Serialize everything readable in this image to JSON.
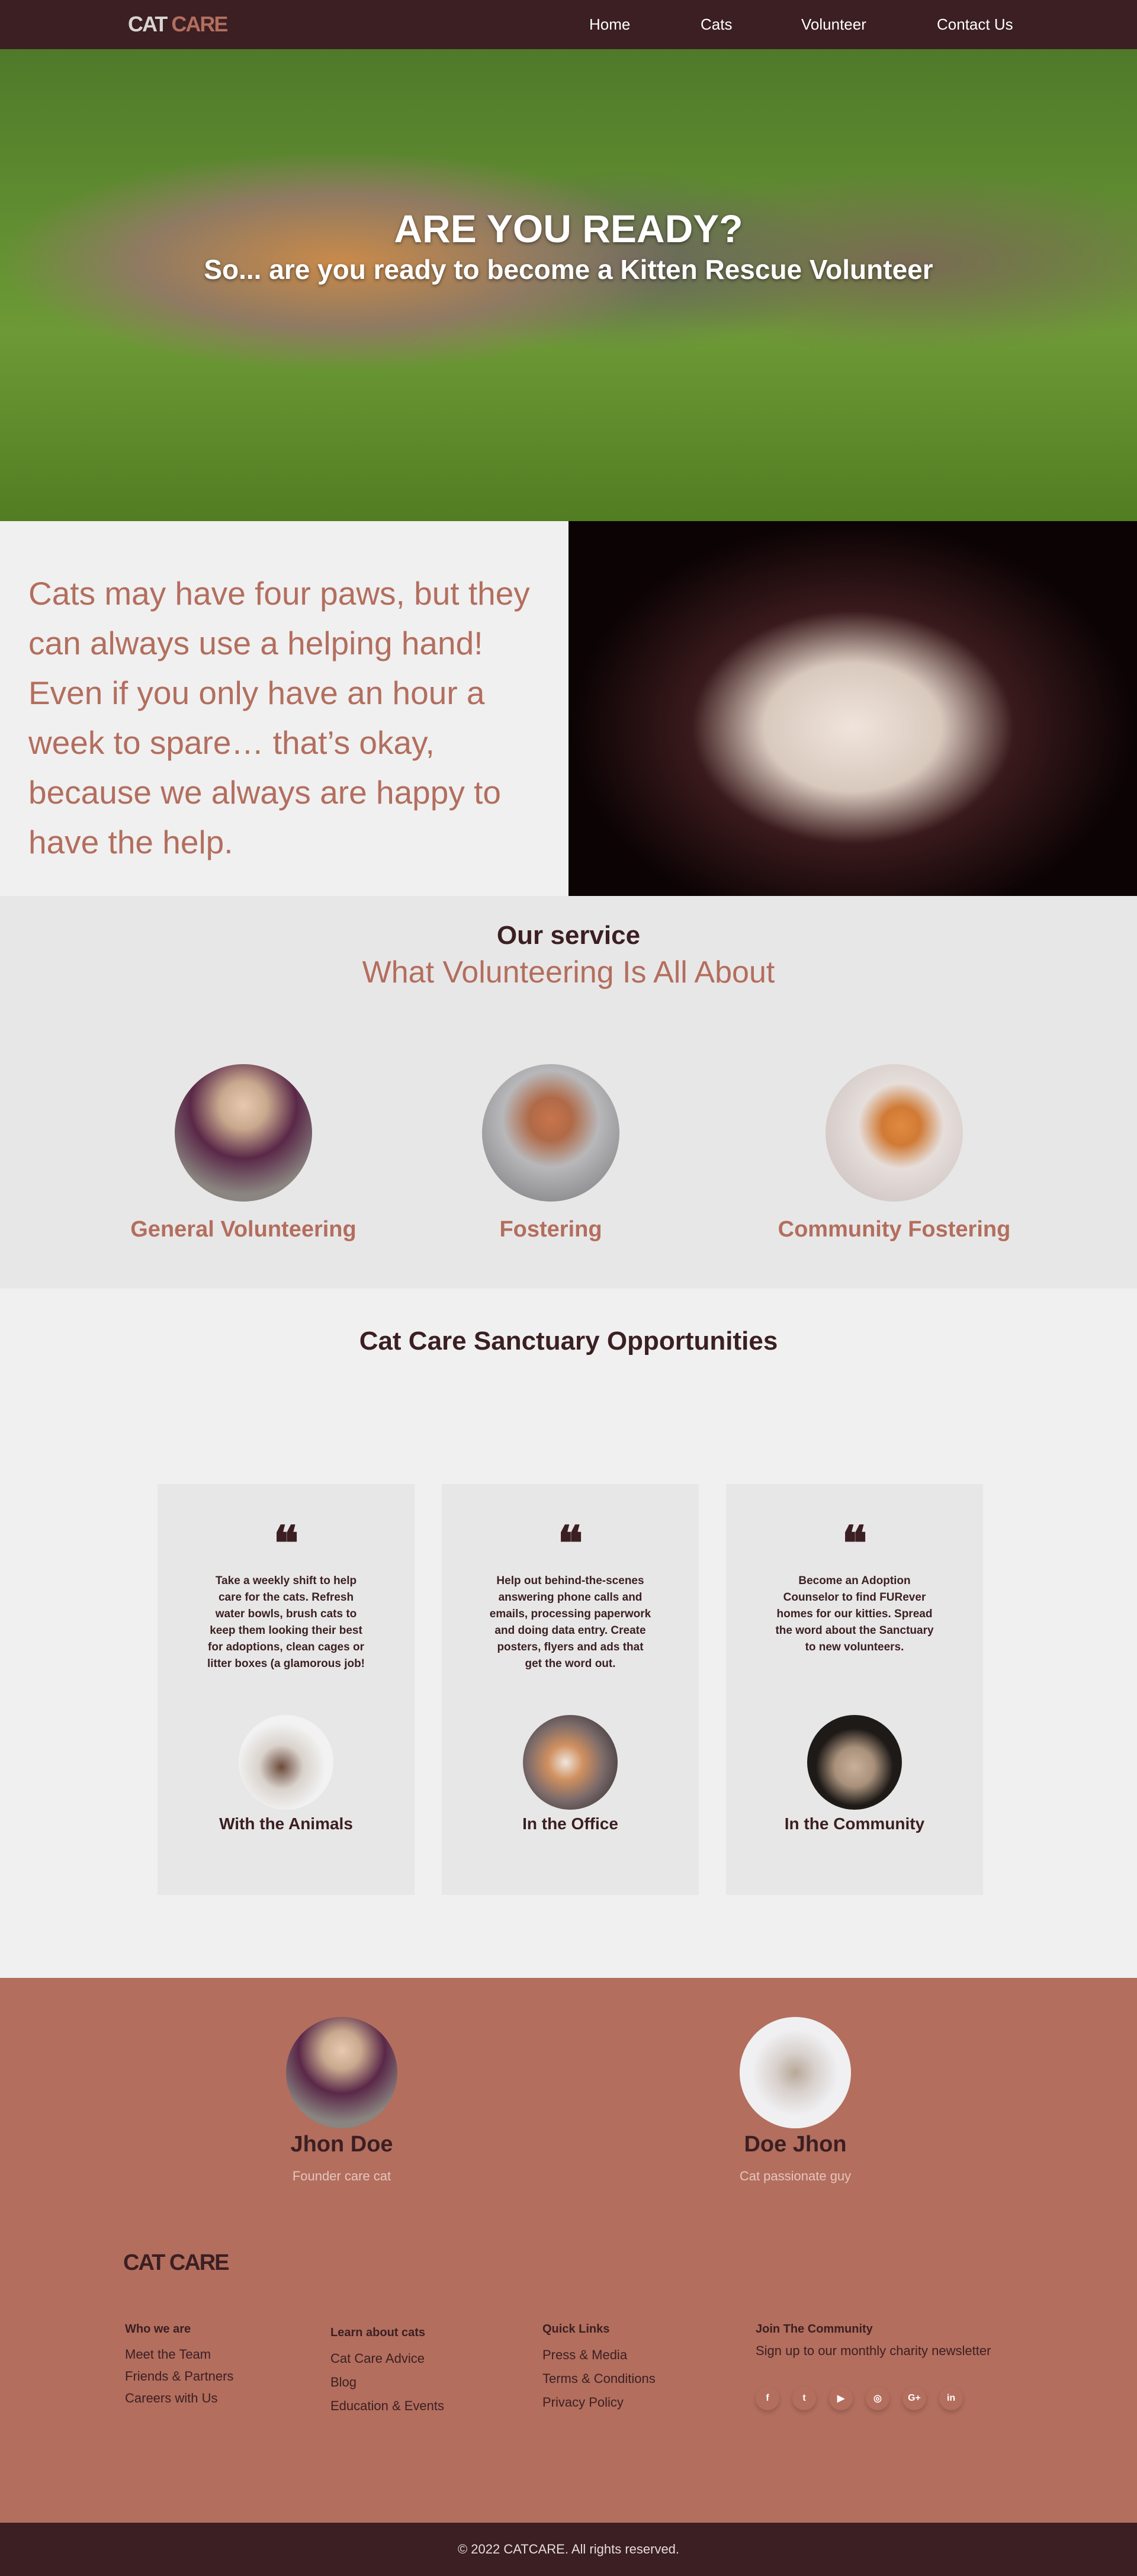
{
  "header": {
    "logo_part1": "CAT",
    "logo_part2": "CARE",
    "nav": [
      "Home",
      "Cats",
      "Volunteer",
      "Contact Us"
    ]
  },
  "hero": {
    "title": "ARE YOU READY?",
    "subtitle": "So... are you ready to become a Kitten Rescue Volunteer"
  },
  "intro": {
    "text": "Cats may have four paws, but they can always use a helping hand! Even if you only have an hour a week to spare… that’s okay, because we always are happy to have the help."
  },
  "service": {
    "title": "Our service",
    "subtitle": "What Volunteering Is All About",
    "items": [
      "General Volunteering",
      "Fostering",
      "Community Fostering"
    ]
  },
  "opportunities": {
    "title": "Cat Care Sanctuary Opportunities",
    "quote_icon": "❝",
    "cards": [
      {
        "text": "Take a weekly shift to help care for the cats. Refresh water bowls, brush cats to keep them looking their best for adoptions, clean cages or litter boxes (a glamorous job!",
        "title": "With the Animals"
      },
      {
        "text": "Help out behind-the-scenes answering phone calls and emails, processing paperwork and doing data entry. Create posters, flyers and ads that get the word out.",
        "title": "In the Office"
      },
      {
        "text": "Become an Adoption Counselor to find FURever homes for our kitties. Spread the word about the Sanctuary to new volunteers.",
        "title": "In the Community"
      }
    ]
  },
  "team": [
    {
      "name": "Jhon Doe",
      "role": "Founder care cat"
    },
    {
      "name": "Doe Jhon",
      "role": "Cat passionate guy"
    }
  ],
  "footer": {
    "logo": "CAT CARE",
    "columns": [
      {
        "title": "Who we are",
        "links": [
          "Meet the Team",
          "Friends & Partners",
          "Careers with Us"
        ]
      },
      {
        "title": "Learn about cats",
        "links": [
          "Cat Care Advice",
          "Blog",
          "Education & Events"
        ]
      },
      {
        "title": "Quick Links",
        "links": [
          "Press & Media",
          "Terms & Conditions",
          "Privacy Policy"
        ]
      }
    ],
    "community": {
      "title": "Join The Community",
      "text": "Sign up to our monthly charity newsletter"
    },
    "social": [
      "f",
      "t",
      "▶",
      "◎",
      "G+",
      "in"
    ],
    "copyright": "© 2022 CATCARE. All rights reserved."
  },
  "colors": {
    "dark": "#3b1f22",
    "accent": "#b36e5e",
    "light": "#f0f0f0"
  }
}
